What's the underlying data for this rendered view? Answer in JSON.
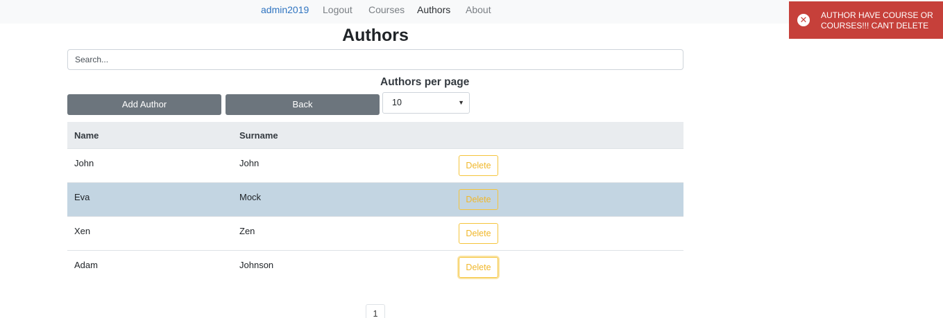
{
  "nav": {
    "user": "admin2019",
    "logout": "Logout",
    "courses": "Courses",
    "authors": "Authors",
    "about": "About"
  },
  "page": {
    "title": "Authors"
  },
  "search": {
    "placeholder": "Search...",
    "value": ""
  },
  "controls": {
    "per_page_label": "Authors per page",
    "add_author": "Add Author",
    "back": "Back",
    "per_page_value": "10"
  },
  "table": {
    "columns": [
      "Name",
      "Surname"
    ],
    "rows": [
      {
        "name": "John",
        "surname": "John",
        "action": "Delete"
      },
      {
        "name": "Eva",
        "surname": "Mock",
        "action": "Delete"
      },
      {
        "name": "Xen",
        "surname": "Zen",
        "action": "Delete"
      },
      {
        "name": "Adam",
        "surname": "Johnson",
        "action": "Delete"
      }
    ]
  },
  "pagination": {
    "current": "1"
  },
  "toast": {
    "message": "AUTHOR HAVE COURSE OR COURSES!!! CANT DELETE",
    "icon": "error-circle-icon"
  },
  "colors": {
    "toast_bg": "#c6403a",
    "selected_row": "#c3d5e2",
    "warning_outline": "#f5c43a",
    "secondary_button": "#6c757d"
  }
}
